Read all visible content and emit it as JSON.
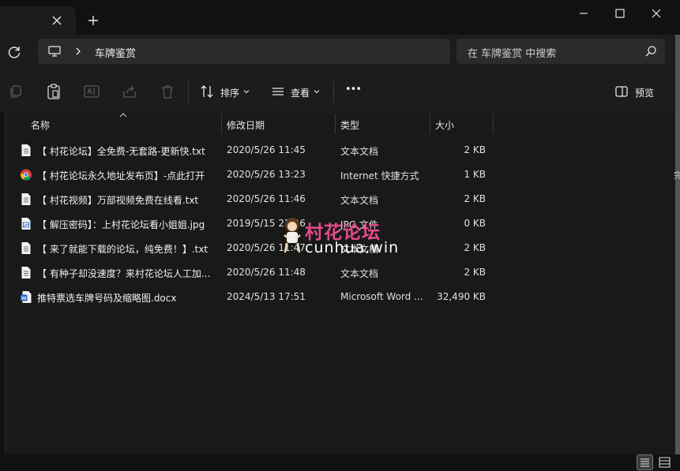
{
  "window": {
    "tab_close_icon": "close-icon",
    "new_tab_icon": "plus-icon",
    "controls": [
      "minimize-icon",
      "maximize-icon",
      "close-icon"
    ]
  },
  "address": {
    "location_icon": "computer-icon",
    "crumb": "车牌鉴赏",
    "search_placeholder": "在 车牌鉴赏 中搜索"
  },
  "toolbar": {
    "sort_label": "排序",
    "view_label": "查看",
    "more_label": "•••",
    "preview_label": "预览"
  },
  "columns": {
    "name": "名称",
    "modified": "修改日期",
    "type": "类型",
    "size": "大小"
  },
  "files": [
    {
      "icon": "text-file-icon",
      "name": "【 村花论坛】全免费-无套路-更新快.txt",
      "modified": "2020/5/26 11:45",
      "type": "文本文档",
      "size": "2 KB"
    },
    {
      "icon": "chrome-shortcut-icon",
      "name": "【 村花论坛永久地址发布页】-点此打开",
      "modified": "2020/5/26 13:23",
      "type": "Internet 快捷方式",
      "size": "1 KB"
    },
    {
      "icon": "text-file-icon",
      "name": "【 村花视频】万部视频免费在线看.txt",
      "modified": "2020/5/26 11:46",
      "type": "文本文档",
      "size": "2 KB"
    },
    {
      "icon": "image-file-icon",
      "name": "【 解压密码】：上村花论坛看小姐姐.jpg",
      "modified": "2019/5/15 22:26",
      "type": "JPG 文件",
      "size": "0 KB"
    },
    {
      "icon": "text-file-icon",
      "name": "【 来了就能下载的论坛，纯免费！】.txt",
      "modified": "2020/5/26 11:47",
      "type": "文本文档",
      "size": "2 KB"
    },
    {
      "icon": "text-file-icon",
      "name": "【 有种子却没速度？来村花论坛人工加...",
      "modified": "2020/5/26 11:48",
      "type": "文本文档",
      "size": "2 KB"
    },
    {
      "icon": "word-file-icon",
      "name": "推特票选车牌号码及缩略图.docx",
      "modified": "2024/5/13 17:51",
      "type": "Microsoft Word ...",
      "size": "32,490 KB"
    }
  ],
  "watermark": {
    "cn": "村花论坛",
    "url": "cunhua.win"
  },
  "edge_glyph": "完",
  "colors": {
    "accent_blue": "#4c8ef7",
    "watermark_pink": "#e64a8a",
    "panel": "#1c1c1c",
    "content": "#191919"
  }
}
